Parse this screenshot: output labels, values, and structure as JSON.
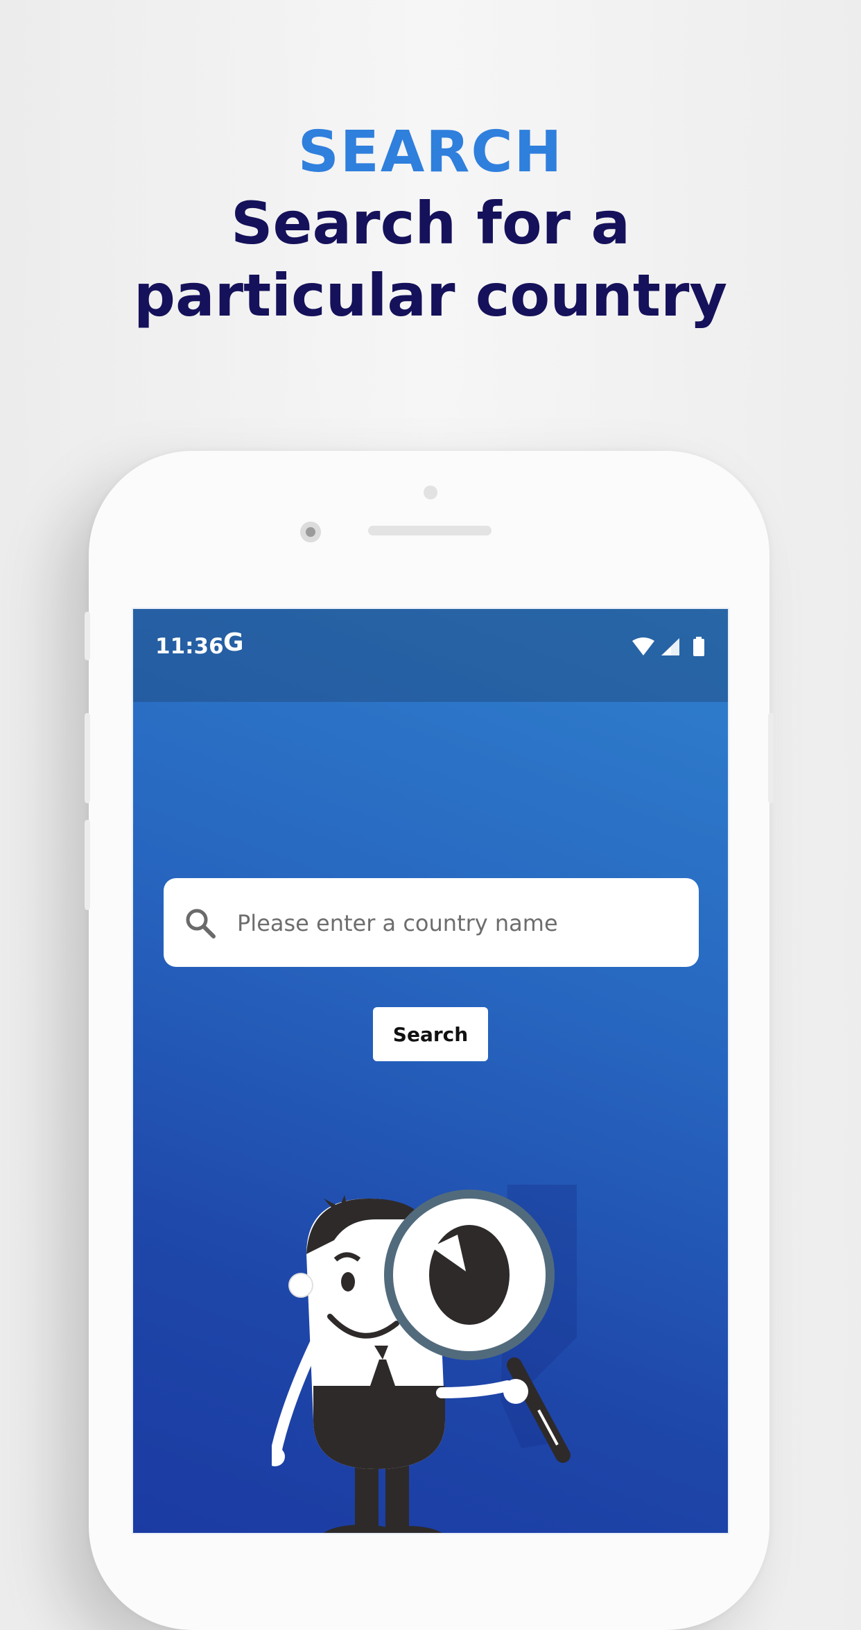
{
  "headline": {
    "eyebrow": "SEARCH",
    "title_line1": "Search for a",
    "title_line2": "particular country"
  },
  "status_bar": {
    "time": "11:36",
    "g_icon": "G",
    "icons": [
      "wifi-icon",
      "signal-icon",
      "battery-icon"
    ]
  },
  "search": {
    "placeholder": "Please enter a country name",
    "button_label": "Search",
    "icon": "search-icon"
  },
  "colors": {
    "eyebrow": "#2f7fdd",
    "title": "#15115a",
    "screen_top": "#3080cd",
    "screen_bottom": "#1b3ba2"
  },
  "illustration": "mascot-with-magnifying-glass"
}
